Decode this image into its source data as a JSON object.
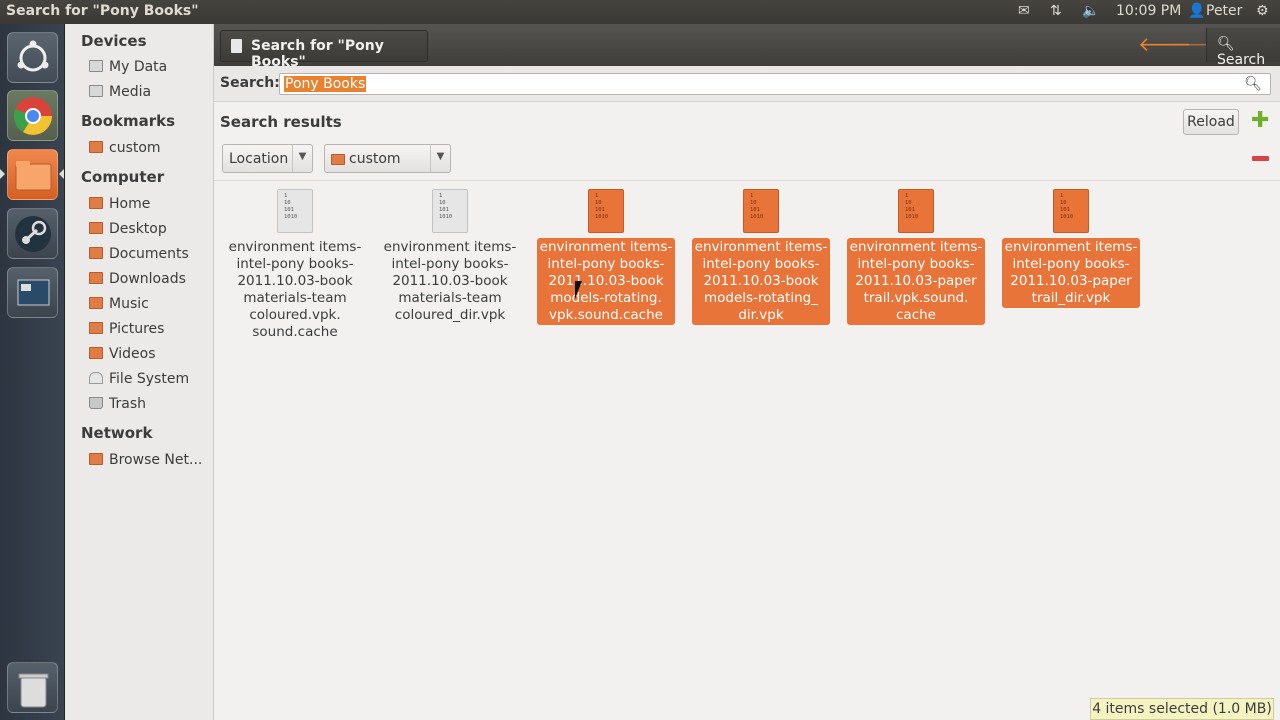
{
  "window_title": "Search for \"Pony Books\"",
  "top_panel": {
    "clock": "10:09 PM",
    "user": "Peter",
    "icons": [
      "mail-icon",
      "network-icon",
      "volume-icon",
      "user-icon",
      "settings-icon"
    ]
  },
  "launcher": {
    "items": [
      "ubuntu-dash-icon",
      "chrome-icon",
      "files-icon",
      "steam-icon",
      "workspace-switcher-icon",
      "trash-icon"
    ]
  },
  "sidebar": {
    "devices_heading": "Devices",
    "devices": [
      "My Data",
      "Media"
    ],
    "bookmarks_heading": "Bookmarks",
    "bookmarks": [
      "custom"
    ],
    "computer_heading": "Computer",
    "computer": [
      "Home",
      "Desktop",
      "Documents",
      "Downloads",
      "Music",
      "Pictures",
      "Videos",
      "File System",
      "Trash"
    ],
    "network_heading": "Network",
    "network": [
      "Browse Net..."
    ]
  },
  "header": {
    "tab_title": "Search for \"Pony Books\"",
    "search_label": "Search"
  },
  "search": {
    "label": "Search:",
    "value": "Pony Books"
  },
  "results": {
    "title": "Search results",
    "reload_label": "Reload",
    "location_combo": "Location",
    "custom_combo": "custom",
    "icon_digits": "1\n10\n101\n1010",
    "files": [
      {
        "name": "environment items-intel-pony books-2011.10.03-book materials-team coloured.vpk. sound.cache",
        "selected": false
      },
      {
        "name": "environment items-intel-pony books-2011.10.03-book materials-team coloured_dir.vpk",
        "selected": false
      },
      {
        "name": "environment items-intel-pony books-2011.10.03-book models-rotating. vpk.sound.cache",
        "selected": true
      },
      {
        "name": "environment items-intel-pony books-2011.10.03-book models-rotating_ dir.vpk",
        "selected": true
      },
      {
        "name": "environment items-intel-pony books-2011.10.03-paper trail.vpk.sound. cache",
        "selected": true
      },
      {
        "name": "environment items-intel-pony books-2011.10.03-paper trail_dir.vpk",
        "selected": true
      }
    ]
  },
  "status": "4 items selected (1.0 MB)",
  "colors": {
    "accent": "#e9822f",
    "selection": "#e9743a",
    "panel": "#3c3b37"
  }
}
